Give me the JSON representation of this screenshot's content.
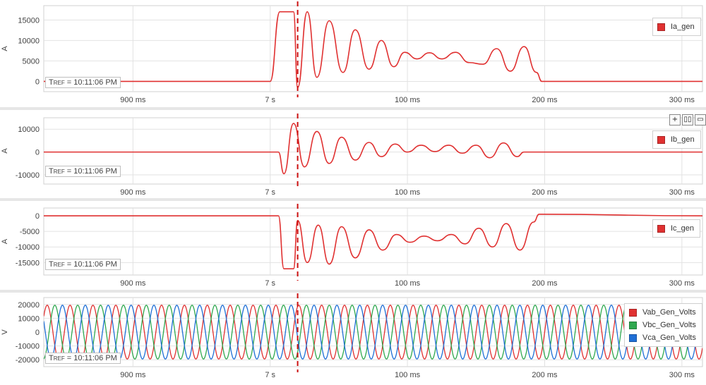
{
  "colors": {
    "trace_red": "#e03131",
    "trace_green": "#2fa84f",
    "trace_blue": "#1f6fd6",
    "cursor": "#cc1111",
    "grid": "#e2e2e2"
  },
  "time_axis": {
    "tick_labels": [
      "900 ms",
      "7 s",
      "100 ms",
      "200 ms",
      "300 ms"
    ],
    "tick_times_s": [
      6.9,
      7.0,
      7.1,
      7.2,
      7.3
    ],
    "range_s": [
      6.835,
      7.315
    ],
    "cursor_time_s": 7.02
  },
  "tref_label": {
    "prefix": "T",
    "sub": "REF",
    "value": " = 10:11:06 PM"
  },
  "toolbar": {
    "add_icon": "plus-icon",
    "split_icon": "split-columns-icon",
    "stack_icon": "stack-rows-icon"
  },
  "chart_data": [
    {
      "type": "line",
      "name": "Ia_gen",
      "ylabel": "A",
      "yticks": [
        0,
        5000,
        10000,
        15000
      ],
      "ytick_labels": [
        "0",
        "5000",
        "10000",
        "15000"
      ],
      "ylim": [
        -2500,
        18500
      ],
      "series": [
        {
          "name": "Ia_gen",
          "color": "#e03131",
          "x": [
            6.835,
            7.0,
            7.007,
            7.017,
            7.02,
            7.027,
            7.034,
            7.043,
            7.053,
            7.062,
            7.072,
            7.081,
            7.09,
            7.098,
            7.107,
            7.116,
            7.125,
            7.135,
            7.145,
            7.155,
            7.165,
            7.175,
            7.185,
            7.194,
            7.198,
            7.315
          ],
          "y": [
            0,
            0,
            17000,
            17000,
            -1500,
            17000,
            1000,
            14800,
            2200,
            12600,
            3000,
            10000,
            3600,
            7100,
            5500,
            7000,
            5500,
            7100,
            4600,
            4200,
            8000,
            2500,
            8500,
            2200,
            0,
            0
          ]
        }
      ]
    },
    {
      "type": "line",
      "name": "Ib_gen",
      "ylabel": "A",
      "yticks": [
        -10000,
        0,
        10000
      ],
      "ytick_labels": [
        "-10000",
        "0",
        "10000"
      ],
      "ylim": [
        -14000,
        15000
      ],
      "series": [
        {
          "name": "Ib_gen",
          "color": "#e03131",
          "x": [
            6.835,
            7.006,
            7.01,
            7.017,
            7.025,
            7.034,
            7.043,
            7.052,
            7.062,
            7.072,
            7.081,
            7.091,
            7.1,
            7.11,
            7.12,
            7.13,
            7.14,
            7.15,
            7.16,
            7.17,
            7.18,
            7.185,
            7.315
          ],
          "y": [
            0,
            0,
            -9500,
            12500,
            -6500,
            9000,
            -5000,
            6500,
            -3500,
            4200,
            -2000,
            3500,
            0,
            3000,
            200,
            3000,
            -500,
            3000,
            -2500,
            4000,
            -2000,
            0,
            0
          ]
        }
      ]
    },
    {
      "type": "line",
      "name": "Ic_gen",
      "ylabel": "A",
      "yticks": [
        -15000,
        -10000,
        -5000,
        0
      ],
      "ytick_labels": [
        "-15000",
        "-10000",
        "-5000",
        "0"
      ],
      "ylim": [
        -19000,
        2500
      ],
      "series": [
        {
          "name": "Ic_gen",
          "color": "#e03131",
          "x": [
            6.835,
            7.006,
            7.01,
            7.017,
            7.02,
            7.027,
            7.035,
            7.043,
            7.052,
            7.062,
            7.072,
            7.082,
            7.092,
            7.102,
            7.112,
            7.122,
            7.132,
            7.142,
            7.152,
            7.162,
            7.172,
            7.182,
            7.192,
            7.196,
            7.315
          ],
          "y": [
            0,
            0,
            -17000,
            -17000,
            -1500,
            -15000,
            -3000,
            -15500,
            -3500,
            -13500,
            -4500,
            -11000,
            -6000,
            -8500,
            -6500,
            -8000,
            -6000,
            -9000,
            -4000,
            -10000,
            -2500,
            -11000,
            -2000,
            500,
            0
          ]
        }
      ]
    },
    {
      "type": "line",
      "name": "Gen_Volts",
      "ylabel": "V",
      "yticks": [
        -20000,
        -10000,
        0,
        10000,
        20000
      ],
      "ytick_labels": [
        "-20000",
        "-10000",
        "0",
        "10000",
        "20000"
      ],
      "ylim": [
        -25000,
        25000
      ],
      "frequency_hz": 60,
      "amplitude": 19500,
      "series": [
        {
          "name": "Vab_Gen_Volts",
          "color": "#e03131",
          "phase_deg": 0
        },
        {
          "name": "Vbc_Gen_Volts",
          "color": "#2fa84f",
          "phase_deg": -120
        },
        {
          "name": "Vca_Gen_Volts",
          "color": "#1f6fd6",
          "phase_deg": 120
        }
      ]
    }
  ]
}
